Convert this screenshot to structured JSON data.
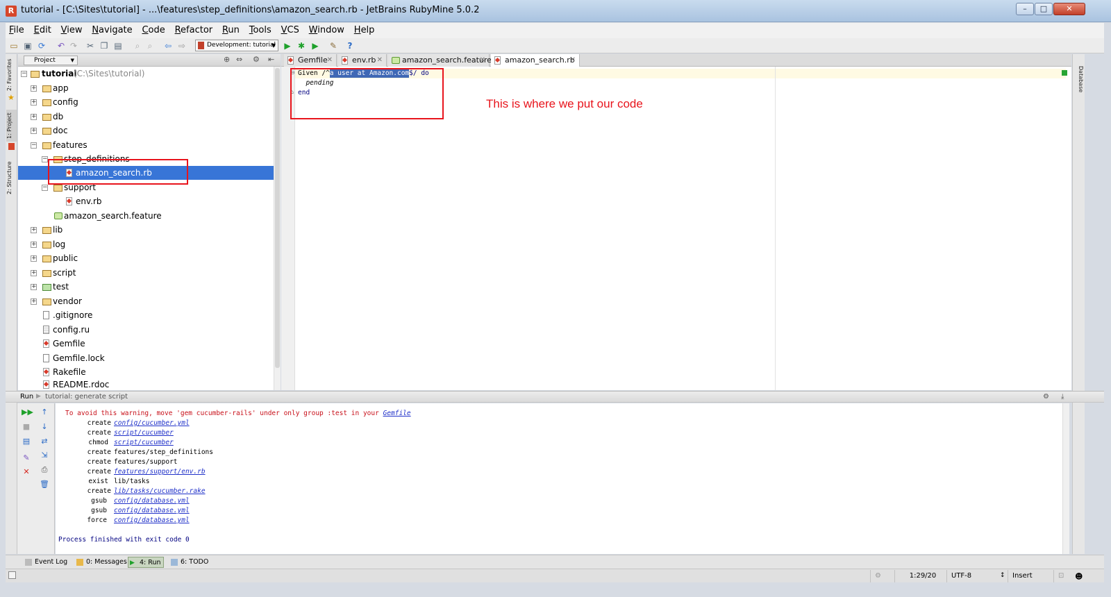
{
  "window": {
    "title": "tutorial - [C:\\Sites\\tutorial] - ...\\features\\step_definitions\\amazon_search.rb - JetBrains RubyMine 5.0.2",
    "controls": [
      "–",
      "□",
      "✕"
    ],
    "app_logo_letter": "R"
  },
  "menu": [
    "File",
    "Edit",
    "View",
    "Navigate",
    "Code",
    "Refactor",
    "Run",
    "Tools",
    "VCS",
    "Window",
    "Help"
  ],
  "toolbar": {
    "run_config": "Development: tutorial",
    "icons": [
      "open-icon",
      "save-icon",
      "sync-icon",
      "undo-icon",
      "redo-icon",
      "cut-icon",
      "copy-icon",
      "paste-icon",
      "find-icon",
      "replace-icon",
      "back-icon",
      "forward-icon",
      "run-icon",
      "debug-icon",
      "coverage-icon",
      "settings-icon",
      "help-icon"
    ]
  },
  "side_tabs": {
    "left": [
      "2: Favorites",
      "1: Project",
      "2: Structure"
    ],
    "right": [
      "Database"
    ]
  },
  "project": {
    "header": "Project",
    "root_name": "tutorial",
    "root_path": "(C:\\Sites\\tutorial)",
    "tree": [
      {
        "label": "app",
        "kind": "folder"
      },
      {
        "label": "config",
        "kind": "folder"
      },
      {
        "label": "db",
        "kind": "folder"
      },
      {
        "label": "doc",
        "kind": "folder"
      },
      {
        "label": "features",
        "kind": "folder"
      },
      {
        "label": "step_definitions",
        "kind": "folder"
      },
      {
        "label": "amazon_search.rb",
        "kind": "rb"
      },
      {
        "label": "support",
        "kind": "folder"
      },
      {
        "label": "env.rb",
        "kind": "rb"
      },
      {
        "label": "amazon_search.feature",
        "kind": "feature"
      },
      {
        "label": "lib",
        "kind": "folder"
      },
      {
        "label": "log",
        "kind": "folder"
      },
      {
        "label": "public",
        "kind": "folder"
      },
      {
        "label": "script",
        "kind": "folder"
      },
      {
        "label": "test",
        "kind": "folder"
      },
      {
        "label": "vendor",
        "kind": "folder"
      },
      {
        "label": ".gitignore",
        "kind": "plain"
      },
      {
        "label": "config.ru",
        "kind": "plain"
      },
      {
        "label": "Gemfile",
        "kind": "rb"
      },
      {
        "label": "Gemfile.lock",
        "kind": "plain"
      },
      {
        "label": "Rakefile",
        "kind": "rb"
      },
      {
        "label": "README.rdoc",
        "kind": "rb"
      }
    ]
  },
  "editor": {
    "tabs": [
      "Gemfile",
      "env.rb",
      "amazon_search.feature",
      "amazon_search.rb"
    ],
    "active_tab": "amazon_search.rb",
    "code": {
      "line1_pre": "Given /^",
      "line1_sel": "a user at Amazon.com",
      "line1_post": "$/ do",
      "line2": "  pending",
      "line3": "end"
    },
    "annotation": "This is where we put our code"
  },
  "run_panel": {
    "header_label": "Run",
    "header_config": "tutorial: generate script",
    "lines": [
      {
        "verb": "",
        "path": "To avoid this warning, move 'gem cucumber-rails' under only group :test in your ",
        "link": "Gemfile",
        "warn": true
      },
      {
        "verb": "create",
        "path": "",
        "link": "config/cucumber.yml"
      },
      {
        "verb": "create",
        "path": "",
        "link": "script/cucumber"
      },
      {
        "verb": "chmod",
        "path": "",
        "link": "script/cucumber"
      },
      {
        "verb": "create",
        "path": "features/step_definitions",
        "link": ""
      },
      {
        "verb": "create",
        "path": "features/support",
        "link": ""
      },
      {
        "verb": "create",
        "path": "",
        "link": "features/support/env.rb"
      },
      {
        "verb": "exist",
        "path": "lib/tasks",
        "link": ""
      },
      {
        "verb": "create",
        "path": "",
        "link": "lib/tasks/cucumber.rake"
      },
      {
        "verb": "gsub",
        "path": "",
        "link": "config/database.yml"
      },
      {
        "verb": "gsub",
        "path": "",
        "link": "config/database.yml"
      },
      {
        "verb": "force",
        "path": "",
        "link": "config/database.yml"
      }
    ],
    "finished": "Process finished with exit code 0"
  },
  "bottom_tabs": [
    "Event Log",
    "0: Messages",
    "4: Run",
    "6: TODO"
  ],
  "status": {
    "position": "1:29/20",
    "encoding": "UTF-8",
    "mode": "Insert"
  },
  "colors": {
    "selection": "#3875d7",
    "annotation": "#e8141c",
    "console_link": "#1f30c9",
    "console_warn": "#c8101a"
  }
}
